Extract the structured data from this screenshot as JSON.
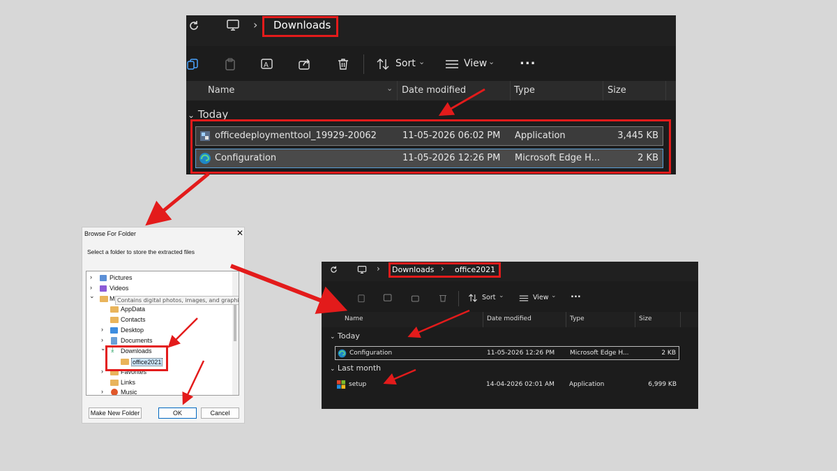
{
  "explorer_top": {
    "breadcrumb": [
      "Downloads"
    ],
    "toolbar": {
      "sort_label": "Sort",
      "view_label": "View",
      "more_label": "..."
    },
    "columns": [
      "Name",
      "Date modified",
      "Type",
      "Size"
    ],
    "group": "Today",
    "rows": [
      {
        "name": "officedeploymenttool_19929-20062",
        "date": "11-05-2026 06:02 PM",
        "type": "Application",
        "size": "3,445 KB",
        "icon": "installer-icon"
      },
      {
        "name": "Configuration",
        "date": "11-05-2026 12:26 PM",
        "type": "Microsoft Edge H...",
        "size": "2 KB",
        "icon": "edge-icon"
      }
    ]
  },
  "browse_dialog": {
    "title": "Browse For Folder",
    "prompt": "Select a folder to store the extracted files",
    "tooltip": "Contains digital photos, images, and graphic f",
    "tree": [
      {
        "label": "Pictures",
        "level": 1,
        "expander": "›"
      },
      {
        "label": "Videos",
        "level": 1,
        "expander": "›"
      },
      {
        "label": "M",
        "level": 1,
        "expander": "⌄"
      },
      {
        "label": "AppData",
        "level": 2,
        "expander": ""
      },
      {
        "label": "Contacts",
        "level": 2,
        "expander": ""
      },
      {
        "label": "Desktop",
        "level": 2,
        "expander": "›"
      },
      {
        "label": "Documents",
        "level": 2,
        "expander": "›"
      },
      {
        "label": "Downloads",
        "level": 2,
        "expander": "⌄"
      },
      {
        "label": "office2021",
        "level": 3,
        "expander": ""
      },
      {
        "label": "Favorites",
        "level": 2,
        "expander": "›"
      },
      {
        "label": "Links",
        "level": 2,
        "expander": ""
      },
      {
        "label": "Music",
        "level": 2,
        "expander": "›"
      }
    ],
    "buttons": {
      "make_new_folder": "Make New Folder",
      "ok": "OK",
      "cancel": "Cancel"
    }
  },
  "explorer_bottom": {
    "breadcrumb": [
      "Downloads",
      "office2021"
    ],
    "toolbar": {
      "sort_label": "Sort",
      "view_label": "View",
      "more_label": "..."
    },
    "columns": [
      "Name",
      "Date modified",
      "Type",
      "Size"
    ],
    "groups": [
      {
        "label": "Today",
        "rows": [
          {
            "name": "Configuration",
            "date": "11-05-2026 12:26 PM",
            "type": "Microsoft Edge H...",
            "size": "2 KB",
            "icon": "edge-icon"
          }
        ]
      },
      {
        "label": "Last month",
        "rows": [
          {
            "name": "setup",
            "date": "14-04-2026 02:01 AM",
            "type": "Application",
            "size": "6,999 KB",
            "icon": "office-setup-icon"
          }
        ]
      }
    ]
  },
  "colors": {
    "highlight_red": "#e31b1b",
    "explorer_bg": "#1c1c1c",
    "page_bg": "#d7d7d7"
  }
}
